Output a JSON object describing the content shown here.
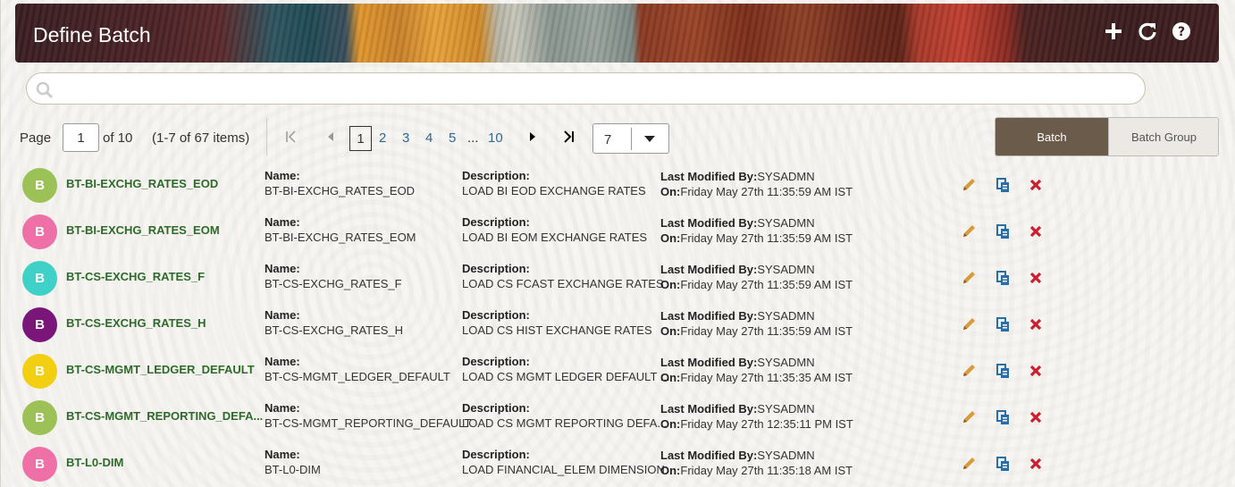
{
  "header": {
    "title": "Define Batch",
    "actions": [
      {
        "name": "add-icon"
      },
      {
        "name": "refresh-icon"
      },
      {
        "name": "help-icon"
      }
    ]
  },
  "search": {
    "placeholder": "",
    "value": ""
  },
  "pager": {
    "page_label": "Page",
    "current_page": "1",
    "of_label": "of 10",
    "items_label": "(1-7 of 67 items)",
    "pages": [
      "1",
      "2",
      "3",
      "4",
      "5",
      "...",
      "10"
    ],
    "page_size": "7"
  },
  "view_toggle": {
    "batch": "Batch",
    "batch_group": "Batch Group",
    "active": "Batch"
  },
  "labels": {
    "name": "Name:",
    "description": "Description:",
    "last_modified_by": "Last Modified By:",
    "on": "On:"
  },
  "rows": [
    {
      "badge": "B",
      "badge_color": "#9cc257",
      "code": "BT-BI-EXCHG_RATES_EOD",
      "name": "BT-BI-EXCHG_RATES_EOD",
      "description": "LOAD BI EOD EXCHANGE RATES",
      "modified_by": "SYSADMN",
      "modified_on": "Friday May 27th 11:35:59 AM IST"
    },
    {
      "badge": "B",
      "badge_color": "#ef6fa7",
      "code": "BT-BI-EXCHG_RATES_EOM",
      "name": "BT-BI-EXCHG_RATES_EOM",
      "description": "LOAD BI EOM EXCHANGE RATES",
      "modified_by": "SYSADMN",
      "modified_on": "Friday May 27th 11:35:59 AM IST"
    },
    {
      "badge": "B",
      "badge_color": "#3fd1c8",
      "code": "BT-CS-EXCHG_RATES_F",
      "name": "BT-CS-EXCHG_RATES_F",
      "description": "LOAD CS FCAST EXCHANGE RATES",
      "modified_by": "SYSADMN",
      "modified_on": "Friday May 27th 11:35:59 AM IST"
    },
    {
      "badge": "B",
      "badge_color": "#7a1679",
      "code": "BT-CS-EXCHG_RATES_H",
      "name": "BT-CS-EXCHG_RATES_H",
      "description": "LOAD CS HIST EXCHANGE RATES",
      "modified_by": "SYSADMN",
      "modified_on": "Friday May 27th 11:35:59 AM IST"
    },
    {
      "badge": "B",
      "badge_color": "#f2cf10",
      "code": "BT-CS-MGMT_LEDGER_DEFAULT",
      "name": "BT-CS-MGMT_LEDGER_DEFAULT",
      "description": "LOAD CS MGMT LEDGER DEFAULT ...",
      "modified_by": "SYSADMN",
      "modified_on": "Friday May 27th 11:35:35 AM IST"
    },
    {
      "badge": "B",
      "badge_color": "#9cc257",
      "code": "BT-CS-MGMT_REPORTING_DEFA...",
      "name": "BT-CS-MGMT_REPORTING_DEFAULT",
      "description": "LOAD CS MGMT REPORTING DEFA...",
      "modified_by": "SYSADMN",
      "modified_on": "Friday May 27th 12:35:11 PM IST"
    },
    {
      "badge": "B",
      "badge_color": "#ef6fa7",
      "code": "BT-L0-DIM",
      "name": "BT-L0-DIM",
      "description": "LOAD FINANCIAL_ELEM DIMENSION",
      "modified_by": "SYSADMN",
      "modified_on": "Friday May 27th 11:35:18 AM IST"
    }
  ],
  "row_actions": [
    "edit-icon",
    "copy-icon",
    "delete-icon"
  ],
  "colors": {
    "link_green": "#2e6a2a",
    "edit_orange": "#d99a3a",
    "copy_blue": "#2a6ea8",
    "delete_red": "#c8202e",
    "toggle_active": "#6b5b4a"
  }
}
